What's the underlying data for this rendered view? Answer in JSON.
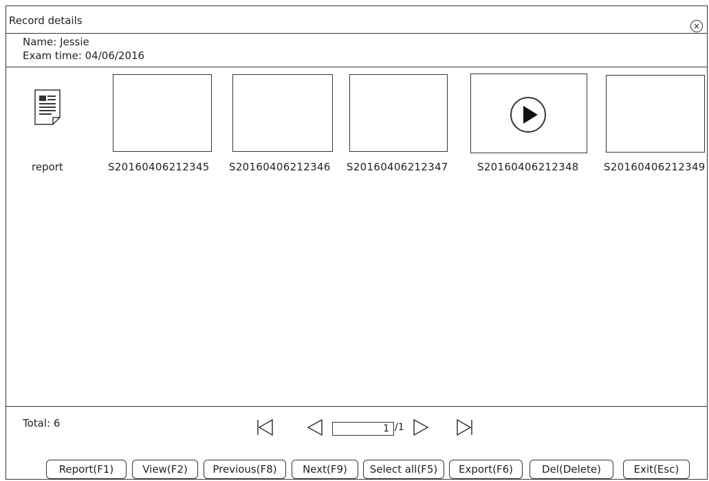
{
  "window": {
    "title": "Record details"
  },
  "record": {
    "name": "Name: Jessie",
    "exam_time": "Exam time: 04/06/2016"
  },
  "report": {
    "label": "report"
  },
  "thumbnails": [
    {
      "id": "S20160406212345"
    },
    {
      "id": "S20160406212346"
    },
    {
      "id": "S20160406212347"
    },
    {
      "id": "S20160406212348",
      "type": "video"
    },
    {
      "id": "S20160406212349"
    }
  ],
  "footer": {
    "total": "Total: 6",
    "page_current": "1",
    "page_total": "/1"
  },
  "buttons": {
    "report": "Report(F1)",
    "view": "View(F2)",
    "previous": "Previous(F8)",
    "next": "Next(F9)",
    "select_all": "Select all(F5)",
    "export": "Export(F6)",
    "del": "Del(Delete)",
    "exit": "Exit(Esc)"
  }
}
